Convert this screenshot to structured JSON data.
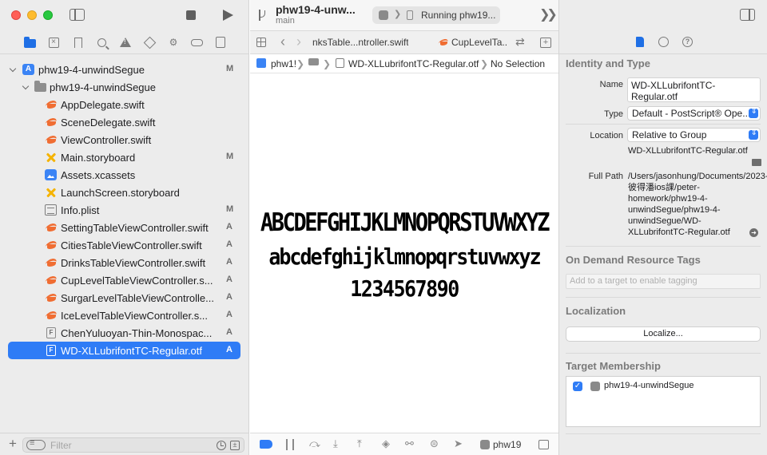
{
  "navigator": {
    "tree": [
      {
        "label": "phw19-4-unwindSegue",
        "badge": "M",
        "icon": "xcode-project-icon"
      },
      {
        "label": "phw19-4-unwindSegue",
        "badge": "",
        "icon": "folder-icon"
      },
      {
        "label": "AppDelegate.swift",
        "badge": "",
        "icon": "swift-file-icon"
      },
      {
        "label": "SceneDelegate.swift",
        "badge": "",
        "icon": "swift-file-icon"
      },
      {
        "label": "ViewController.swift",
        "badge": "",
        "icon": "swift-file-icon"
      },
      {
        "label": "Main.storyboard",
        "badge": "M",
        "icon": "storyboard-icon"
      },
      {
        "label": "Assets.xcassets",
        "badge": "",
        "icon": "asset-catalog-icon"
      },
      {
        "label": "LaunchScreen.storyboard",
        "badge": "",
        "icon": "storyboard-icon"
      },
      {
        "label": "Info.plist",
        "badge": "M",
        "icon": "plist-icon"
      },
      {
        "label": "SettingTableViewController.swift",
        "badge": "A",
        "icon": "swift-file-icon"
      },
      {
        "label": "CitiesTableViewController.swift",
        "badge": "A",
        "icon": "swift-file-icon"
      },
      {
        "label": "DrinksTableViewController.swift",
        "badge": "A",
        "icon": "swift-file-icon"
      },
      {
        "label": "CupLevelTableViewController.s...",
        "badge": "A",
        "icon": "swift-file-icon"
      },
      {
        "label": "SurgarLevelTableViewControlle...",
        "badge": "A",
        "icon": "swift-file-icon"
      },
      {
        "label": "IceLevelTableViewController.s...",
        "badge": "A",
        "icon": "swift-file-icon"
      },
      {
        "label": "ChenYuluoyan-Thin-Monospac...",
        "badge": "A",
        "icon": "font-file-icon"
      },
      {
        "label": "WD-XLLubrifontTC-Regular.otf",
        "badge": "A",
        "icon": "font-file-icon"
      }
    ],
    "filter_placeholder": "Filter",
    "add_label": "+"
  },
  "toolbar": {
    "project_name": "phw19-4-unw...",
    "branch": "main",
    "status": "Running phw19..."
  },
  "tabs": {
    "tab1": "nksTable...ntroller.swift",
    "tab2": "CupLevelTa...r"
  },
  "jumpbar": {
    "project": "phw1!",
    "file": "WD-XLLubrifontTC-Regular.otf",
    "selection": "No Selection"
  },
  "preview": {
    "uppercase": "ABCDEFGHIJKLMNOPQRSTUVWXYZ",
    "lowercase": "abcdefghijklmnopqrstuvwxyz",
    "digits": "1234567890"
  },
  "debug": {
    "scheme": "phw19"
  },
  "inspector": {
    "identity_title": "Identity and Type",
    "name_label": "Name",
    "name_value": "WD-XLLubrifontTC-Regular.otf",
    "type_label": "Type",
    "type_value": "Default - PostScript® Ope...",
    "location_label": "Location",
    "location_value": "Relative to Group",
    "location_file": "WD-XLLubrifontTC-Regular.otf",
    "fullpath_label": "Full Path",
    "fullpath_value": "/Users/jasonhung/Documents/2023-彼得潘ios課/peter-homework/phw19-4-unwindSegue/phw19-4-unwindSegue/WD-XLLubrifontTC-Regular.otf",
    "odr_title": "On Demand Resource Tags",
    "odr_placeholder": "Add to a target to enable tagging",
    "localization_title": "Localization",
    "localize_button": "Localize...",
    "target_title": "Target Membership",
    "target_name": "phw19-4-unwindSegue",
    "accent_color": "#2f7cf6"
  }
}
